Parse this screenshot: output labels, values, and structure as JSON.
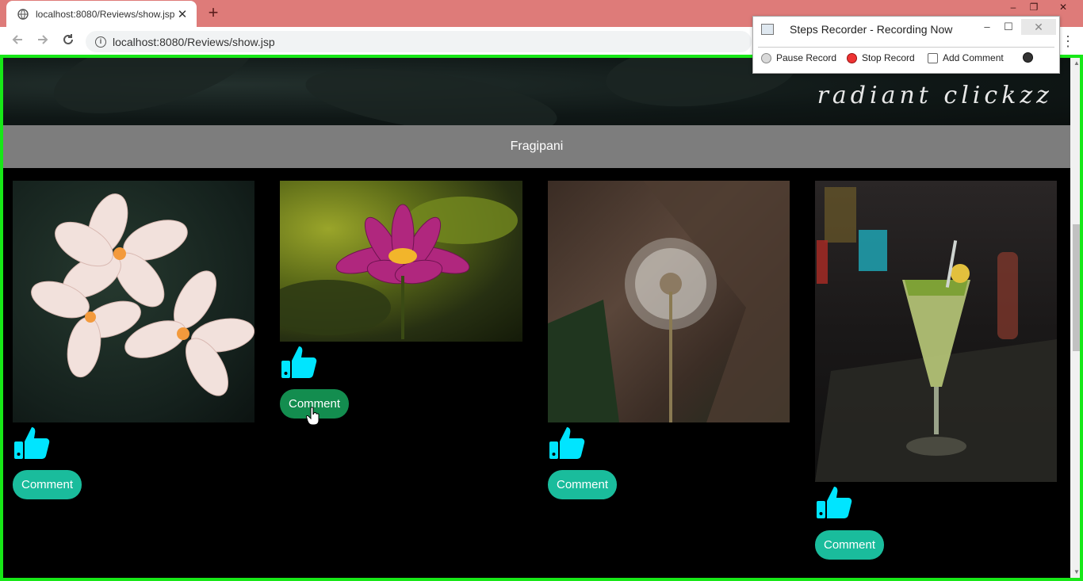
{
  "browser": {
    "tab_title": "localhost:8080/Reviews/show.jsp",
    "tab_close": "✕",
    "new_tab": "+",
    "url": "localhost:8080/Reviews/show.jsp",
    "win_min": "–",
    "win_restore": "❐",
    "win_close": "✕",
    "menu": "⋮"
  },
  "recorder": {
    "title": "Steps Recorder - Recording Now",
    "min": "–",
    "max": "☐",
    "close": "✕",
    "tools": [
      "Pause Record",
      "Stop Record",
      "Add Comment"
    ]
  },
  "page": {
    "brand": "radiant clickzz",
    "section_title": "Fragipani",
    "cards": [
      {
        "photo": "frangipani-flowers",
        "comment_label": "Comment"
      },
      {
        "photo": "water-lily",
        "comment_label": "Comment"
      },
      {
        "photo": "dandelion",
        "comment_label": "Comment"
      },
      {
        "photo": "mojito-glass",
        "comment_label": "Comment"
      }
    ]
  },
  "colors": {
    "tab_bar": "#de7b79",
    "frame": "#17e817",
    "title_bar": "#7d7d7d",
    "button": "#1abc9c",
    "button_active": "#138d4f",
    "like_icon": "#00e5ff"
  }
}
